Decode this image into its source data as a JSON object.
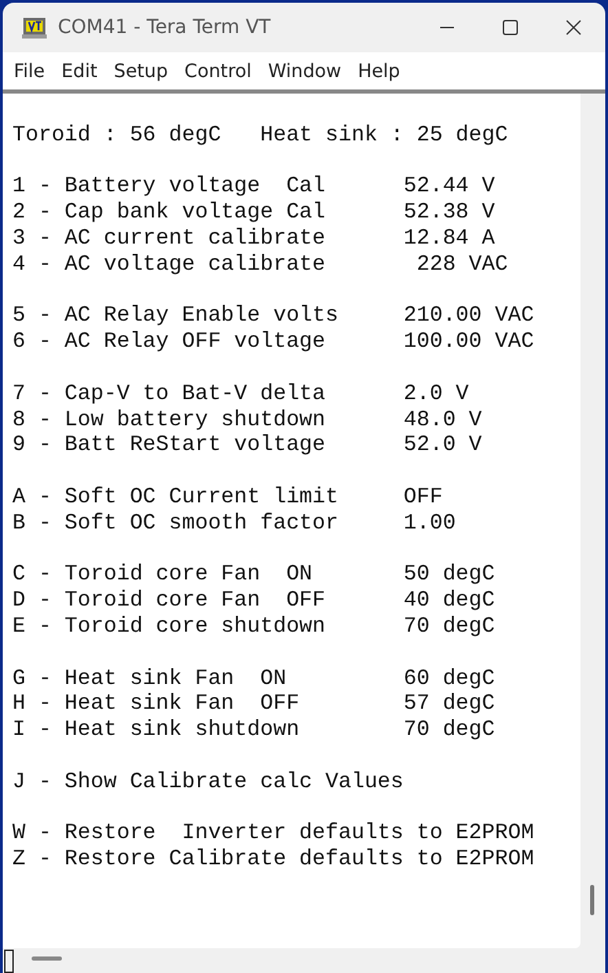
{
  "window": {
    "title": "COM41 - Tera Term VT"
  },
  "menu": [
    "File",
    "Edit",
    "Setup",
    "Control",
    "Window",
    "Help"
  ],
  "terminal": {
    "groups": [
      [
        "Toroid : 56 degC   Heat sink : 25 degC"
      ],
      [
        "1 - Battery voltage  Cal      52.44 V",
        "2 - Cap bank voltage Cal      52.38 V",
        "3 - AC current calibrate      12.84 A",
        "4 - AC voltage calibrate       228 VAC"
      ],
      [
        "5 - AC Relay Enable volts     210.00 VAC",
        "6 - AC Relay OFF voltage      100.00 VAC"
      ],
      [
        "7 - Cap-V to Bat-V delta      2.0 V",
        "8 - Low battery shutdown      48.0 V",
        "9 - Batt ReStart voltage      52.0 V"
      ],
      [
        "A - Soft OC Current limit     OFF",
        "B - Soft OC smooth factor     1.00"
      ],
      [
        "C - Toroid core Fan  ON       50 degC",
        "D - Toroid core Fan  OFF      40 degC",
        "E - Toroid core shutdown      70 degC"
      ],
      [
        "G - Heat sink Fan  ON         60 degC",
        "H - Heat sink Fan  OFF        57 degC",
        "I - Heat sink shutdown        70 degC"
      ],
      [
        "J - Show Calibrate calc Values"
      ],
      [
        "W - Restore  Inverter defaults to E2PROM",
        "Z - Restore Calibrate defaults to E2PROM"
      ]
    ]
  }
}
